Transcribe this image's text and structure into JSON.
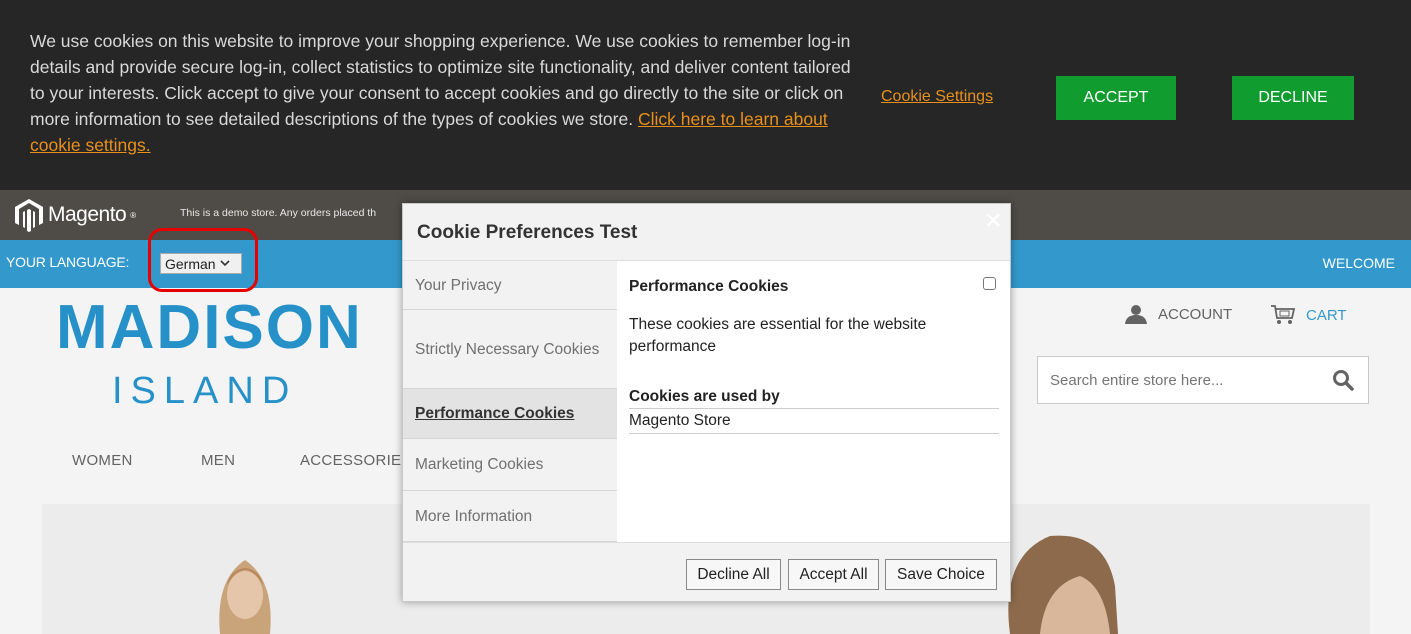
{
  "banner": {
    "text": "We use cookies on this website to improve your shopping experience. We use cookies to remember log-in details and provide secure log-in, collect statistics to optimize site functionality, and deliver content tailored to your interests. Click accept to give your consent to accept cookies and go directly to the site or click on more information to see detailed descriptions of the types of cookies we store. ",
    "link_text": "Click here to learn about cookie settings.",
    "cookie_settings_label": "Cookie Settings",
    "accept_label": "ACCEPT",
    "decline_label": "DECLINE",
    "accent_color": "#e8901b",
    "button_color": "#109c2f"
  },
  "demo_bar": {
    "logo_text": "Magento",
    "notice": "This is a demo store. Any orders placed th"
  },
  "lang_bar": {
    "label": "YOUR LANGUAGE:",
    "selected_language": "German",
    "welcome": "WELCOME"
  },
  "logo": {
    "line1": "MADISON",
    "line2": "ISLAND"
  },
  "header_links": {
    "account": "ACCOUNT",
    "cart": "CART"
  },
  "search": {
    "placeholder": "Search entire store here..."
  },
  "nav": {
    "items": [
      "WOMEN",
      "MEN",
      "ACCESSORIE"
    ]
  },
  "modal": {
    "title": "Cookie Preferences Test",
    "close_glyph": "×",
    "tabs": [
      {
        "label": "Your Privacy"
      },
      {
        "label": "Strictly Necessary Cookies"
      },
      {
        "label": "Performance Cookies"
      },
      {
        "label": "Marketing Cookies"
      },
      {
        "label": "More Information"
      }
    ],
    "active_tab_index": 2,
    "content": {
      "title": "Performance Cookies",
      "description": "These cookies are essential for the website performance",
      "used_by_label": "Cookies are used by",
      "used_by_value": "Magento Store",
      "checked": false
    },
    "buttons": {
      "decline_all": "Decline All",
      "accept_all": "Accept All",
      "save_choice": "Save Choice"
    }
  }
}
